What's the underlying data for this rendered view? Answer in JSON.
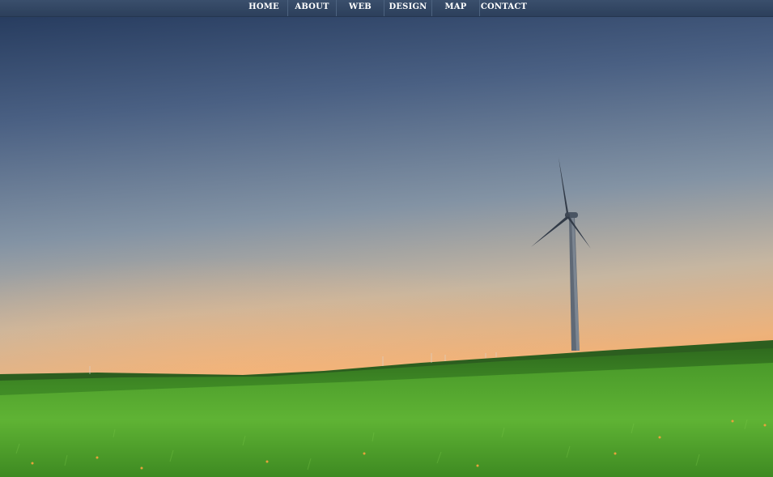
{
  "nav": {
    "items": [
      {
        "label": "HOME"
      },
      {
        "label": "ABOUT"
      },
      {
        "label": "WEB"
      },
      {
        "label": "DESIGN"
      },
      {
        "label": "MAP"
      },
      {
        "label": "CONTACT"
      }
    ]
  },
  "colors": {
    "nav_background": "#33475f",
    "sky_top": "#243a5c",
    "sky_horizon": "#f2a45c",
    "grass": "#4f9a2a"
  }
}
